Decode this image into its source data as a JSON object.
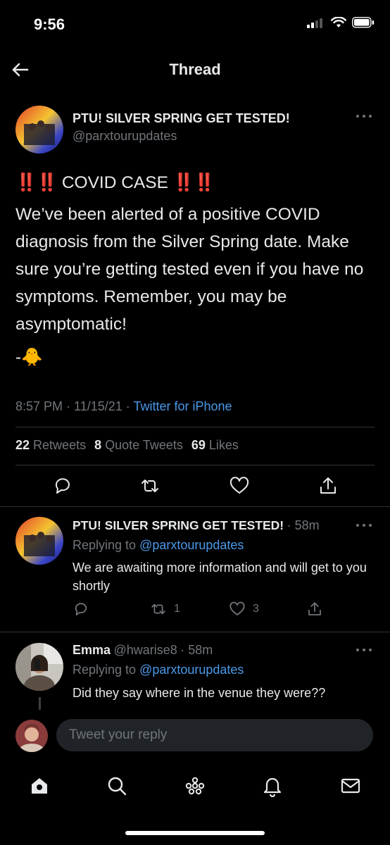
{
  "status_bar": {
    "time": "9:56"
  },
  "header": {
    "title": "Thread"
  },
  "main_tweet": {
    "author_name": "PTU! SILVER SPRING GET TESTED!",
    "author_handle": "@parxtourupdates",
    "alert_emoji": "‼️‼️",
    "alert_text": "COVID CASE",
    "body": "We’ve been alerted of a positive COVID diagnosis from the Silver Spring date. Make sure you’re getting tested even if you have no symptoms. Remember, you may be asymptomatic!",
    "signoff": "-🐥",
    "timestamp": "8:57 PM · 11/15/21 · ",
    "source": "Twitter for iPhone",
    "retweets_count": "22",
    "retweets_label": "Retweets",
    "quotes_count": "8",
    "quotes_label": "Quote Tweets",
    "likes_count": "69",
    "likes_label": "Likes"
  },
  "replies": [
    {
      "author_name": "PTU! SILVER SPRING GET TESTED!",
      "time": "· 58m",
      "replying_prefix": "Replying to ",
      "replying_to": "@parxtourupdates",
      "text": "We are awaiting more information and will get to you shortly",
      "retweets": "1",
      "likes": "3"
    },
    {
      "author_name": "Emma",
      "author_handle": "@hwarise8",
      "time": "· 58m",
      "replying_prefix": "Replying to ",
      "replying_to": "@parxtourupdates",
      "text": "Did they say where in the venue they were??"
    }
  ],
  "compose": {
    "placeholder": "Tweet your reply"
  },
  "icons": {
    "back": "arrow-left-icon",
    "more": "more-dots-icon",
    "reply": "reply-icon",
    "retweet": "retweet-icon",
    "like": "heart-icon",
    "share": "share-icon",
    "home": "home-icon",
    "search": "search-icon",
    "spaces": "spaces-icon",
    "notifications": "bell-icon",
    "messages": "mail-icon"
  },
  "colors": {
    "background": "#000000",
    "link": "#4a99e9",
    "muted": "#71767b",
    "alert": "#e0245e"
  }
}
